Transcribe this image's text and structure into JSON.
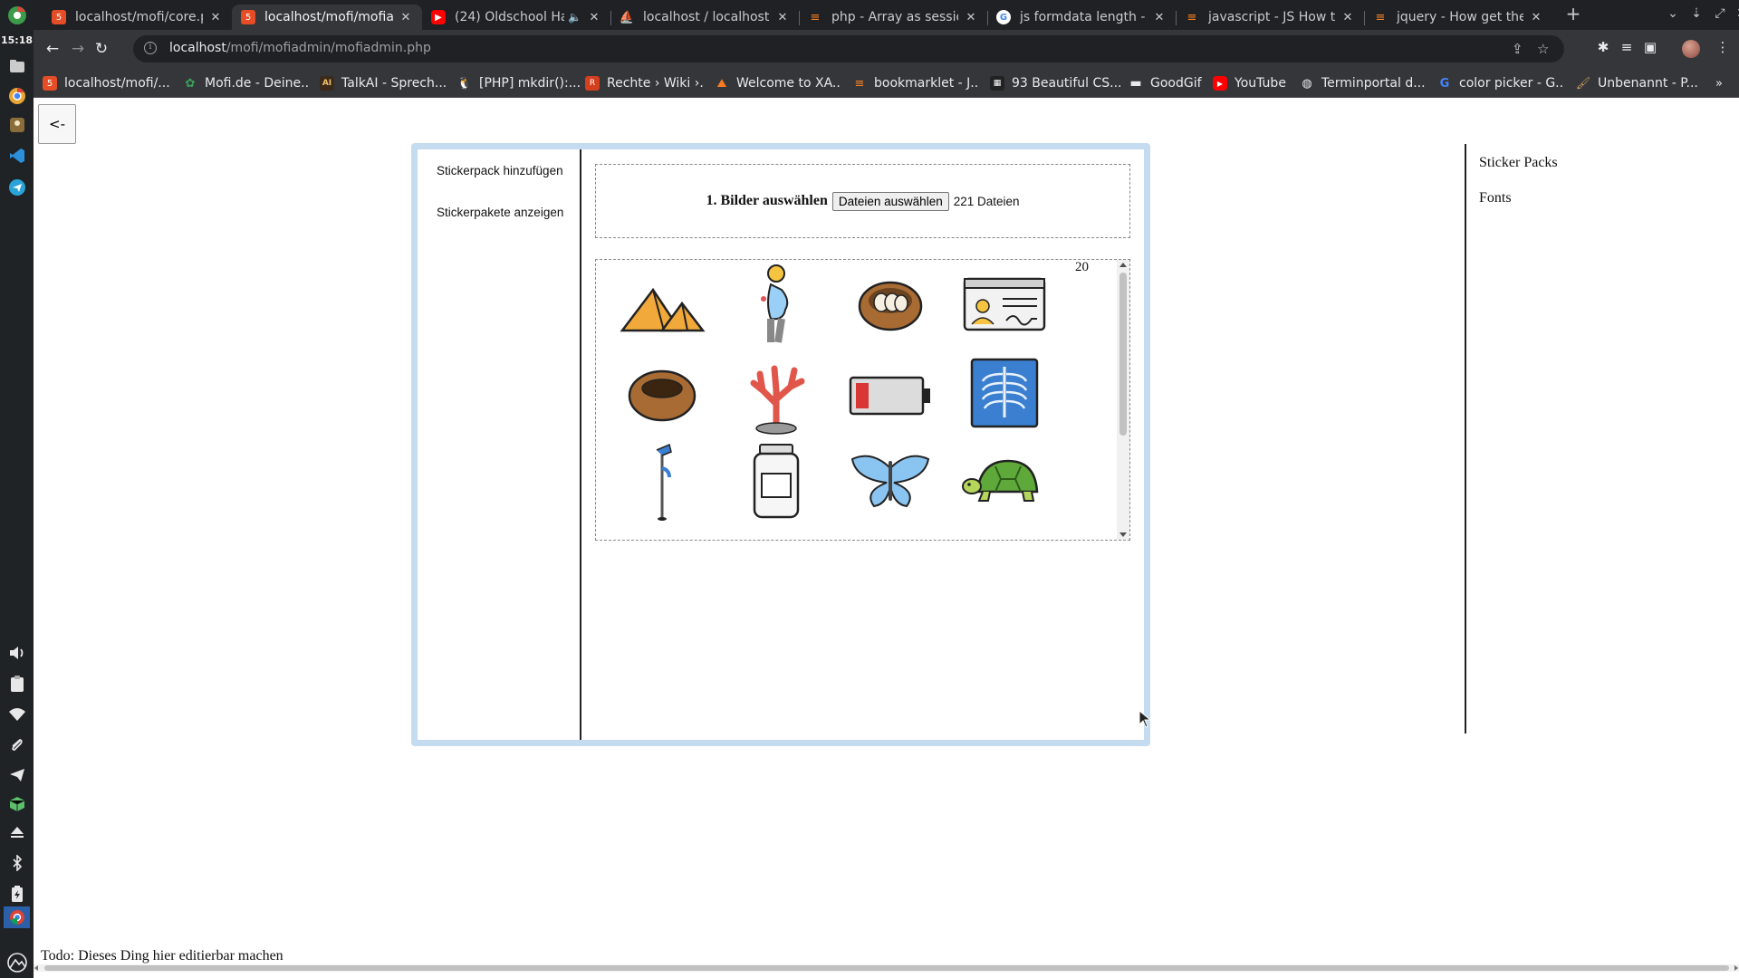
{
  "dock": {
    "clock": "15:18",
    "top_icons": [
      "chrome-icon",
      "files-icon",
      "chrome-icon",
      "contacts-icon",
      "vscode-icon",
      "telegram-icon"
    ],
    "bottom_icons": [
      "volume-icon",
      "clipboard-icon",
      "wifi-icon",
      "paperclip-icon",
      "telegram-icon",
      "package-icon",
      "eject-icon",
      "bluetooth-icon",
      "battery-icon",
      "chrome-icon",
      "activities-icon"
    ]
  },
  "tabs": [
    {
      "title": "localhost/mofi/core.p",
      "favicon": "html-file-icon",
      "active": false
    },
    {
      "title": "localhost/mofi/mofia",
      "favicon": "html-file-icon",
      "active": true
    },
    {
      "title": "(24) Oldschool Ha",
      "favicon": "youtube-icon",
      "active": false,
      "audio": true
    },
    {
      "title": "localhost / localhost",
      "favicon": "phpmyadmin-icon",
      "active": false
    },
    {
      "title": "php - Array as sessio",
      "favicon": "stackoverflow-icon",
      "active": false
    },
    {
      "title": "js formdata length -",
      "favicon": "google-icon",
      "active": false
    },
    {
      "title": "javascript - JS How to",
      "favicon": "stackoverflow-icon",
      "active": false
    },
    {
      "title": "jquery - How get the",
      "favicon": "stackoverflow-icon",
      "active": false
    }
  ],
  "toolbar": {
    "url_host": "localhost",
    "url_path": "/mofi/mofiadmin/mofiadmin.php"
  },
  "bookmarks": [
    {
      "label": "localhost/mofi/...",
      "icon": "html-file-icon",
      "color": "#e44d26"
    },
    {
      "label": "Mofi.de - Deine...",
      "icon": "palm-icon",
      "color": "#3aa35b"
    },
    {
      "label": "TalkAI - Sprech...",
      "icon": "ai-icon",
      "color": "#3b2a1a"
    },
    {
      "label": "[PHP] mkdir():...",
      "icon": "tux-icon",
      "color": "#444444"
    },
    {
      "label": "Rechte › Wiki ›...",
      "icon": "wiki-icon",
      "color": "#d43f1e"
    },
    {
      "label": "Welcome to XA...",
      "icon": "xampp-icon",
      "color": "#fb7a24"
    },
    {
      "label": "bookmarklet - J...",
      "icon": "stackoverflow-icon",
      "color": "#f48024"
    },
    {
      "label": "93 Beautiful CS...",
      "icon": "css-icon",
      "color": "#222222"
    },
    {
      "label": "GoodGif",
      "icon": "folder-icon",
      "color": "#202124"
    },
    {
      "label": "YouTube",
      "icon": "youtube-icon",
      "color": "#ff0000"
    },
    {
      "label": "Terminportal d...",
      "icon": "globe-icon",
      "color": "#5f6368"
    },
    {
      "label": "color picker - G...",
      "icon": "google-icon",
      "color": "#4285f4"
    },
    {
      "label": "Unbenannt - P...",
      "icon": "paint-icon",
      "color": "#8a6d3b"
    }
  ],
  "page": {
    "back_label": "<-",
    "menu": [
      "Stickerpack hinzufügen",
      "Stickerpakete anzeigen"
    ],
    "upload_label": "1. Bilder auswählen",
    "file_button": "Dateien auswählen",
    "file_count": "221 Dateien",
    "sticker_count": "20",
    "stickers": [
      "pyramids-icon",
      "pregnant-woman-icon",
      "nest-with-eggs-icon",
      "id-card-icon",
      "empty-nest-icon",
      "coral-icon",
      "low-battery-icon",
      "x-ray-icon",
      "crutch-icon",
      "jar-icon",
      "butterfly-icon",
      "turtle-icon"
    ],
    "right_links": [
      "Sticker Packs",
      "Fonts"
    ],
    "todo": "Todo: Dieses Ding hier editierbar machen"
  },
  "colors": {
    "frame_border": "#c5dbef",
    "chrome_dark": "#202124",
    "chrome_toolbar": "#35363a"
  }
}
